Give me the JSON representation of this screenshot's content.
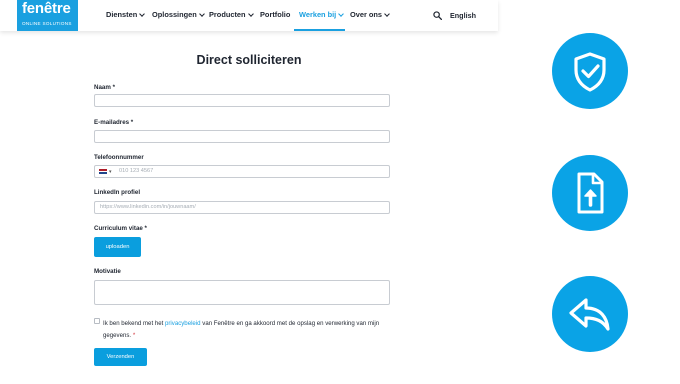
{
  "brand": {
    "name": "fenêtre",
    "tagline": "ONLINE SOLUTIONS",
    "color": "#1aa0e0"
  },
  "nav": {
    "items": [
      {
        "label": "Diensten",
        "dropdown": true
      },
      {
        "label": "Oplossingen",
        "dropdown": true
      },
      {
        "label": "Producten",
        "dropdown": true
      },
      {
        "label": "Portfolio",
        "dropdown": false
      },
      {
        "label": "Werken bij",
        "dropdown": true,
        "active": true
      },
      {
        "label": "Over ons",
        "dropdown": true
      }
    ],
    "language": "English"
  },
  "form": {
    "title": "Direct solliciteren",
    "name_label": "Naam *",
    "email_label": "E-mailadres *",
    "phone_label": "Telefoonnummer",
    "phone_placeholder": "010 123 4567",
    "linkedin_label": "LinkedIn profiel",
    "linkedin_placeholder": "https://www.linkedin.com/in/jouwnaam/",
    "cv_label": "Curriculum vitae *",
    "upload_button": "uploaden",
    "motivation_label": "Motivatie",
    "consent_prefix": "Ik ben bekend met het ",
    "consent_link": "privacybeleid",
    "consent_suffix": " van Fenêtre en ga akkoord met de opslag en verwerking van mijn gegevens.",
    "consent_required": "*",
    "submit_button": "Verzenden"
  },
  "side_icons": [
    "shield-check-icon",
    "file-upload-icon",
    "reply-arrow-icon"
  ],
  "colors": {
    "accent": "#0aa3e6",
    "text": "#1f2530",
    "required": "#d3343c"
  }
}
